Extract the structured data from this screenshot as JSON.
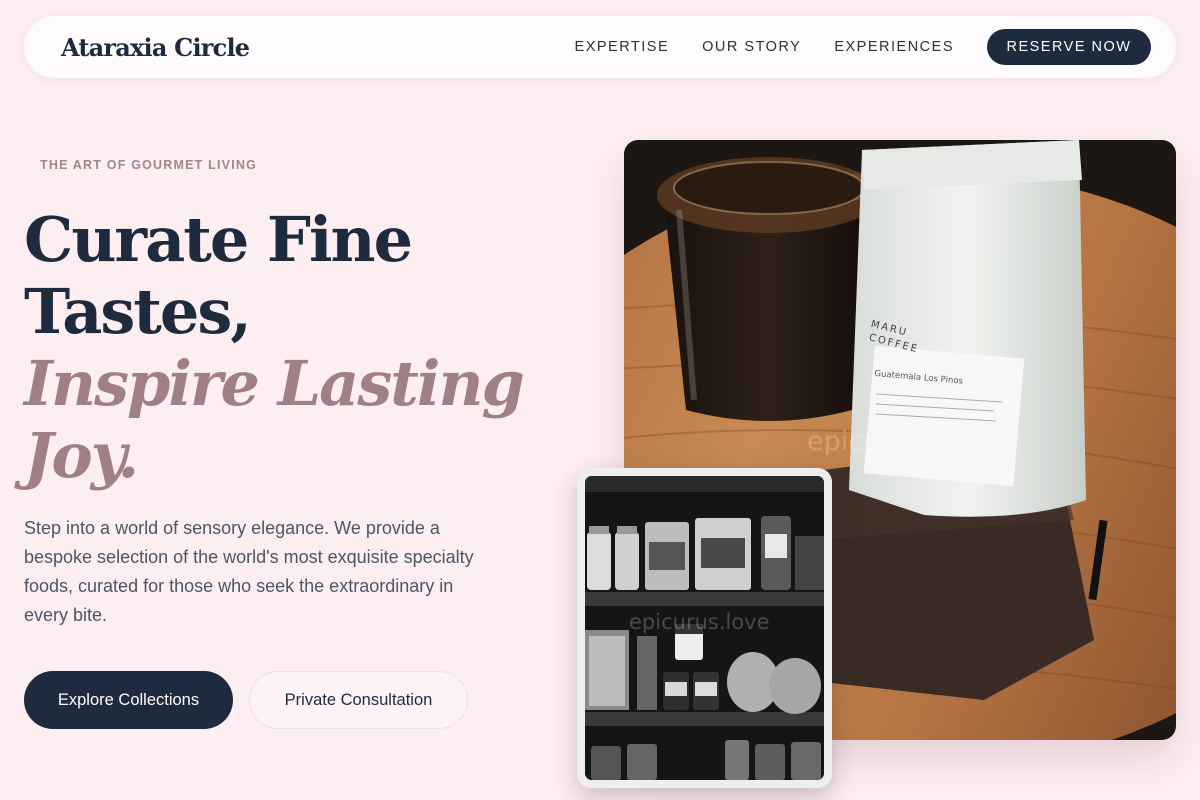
{
  "brand": "Ataraxia Circle",
  "nav": {
    "links": [
      "EXPERTISE",
      "OUR STORY",
      "EXPERIENCES"
    ],
    "cta": "RESERVE NOW"
  },
  "hero": {
    "eyebrow": "THE ART OF GOURMET LIVING",
    "headline_line1": "Curate Fine",
    "headline_line2": "Tastes,",
    "headline_accent1": "Inspire Lasting",
    "headline_accent2": "Joy.",
    "description": "Step into a world of sensory elegance. We provide a bespoke selection of the world's most exquisite specialty foods, curated for those who seek the extraordinary in every bite.",
    "primary_button": "Explore Collections",
    "secondary_button": "Private Consultation"
  },
  "images": {
    "main_bag_brand_line1": "MARU",
    "main_bag_brand_line2": "COFFEE",
    "main_bag_label": "Guatemala Los Pinos",
    "watermark": "epicurus.love"
  }
}
